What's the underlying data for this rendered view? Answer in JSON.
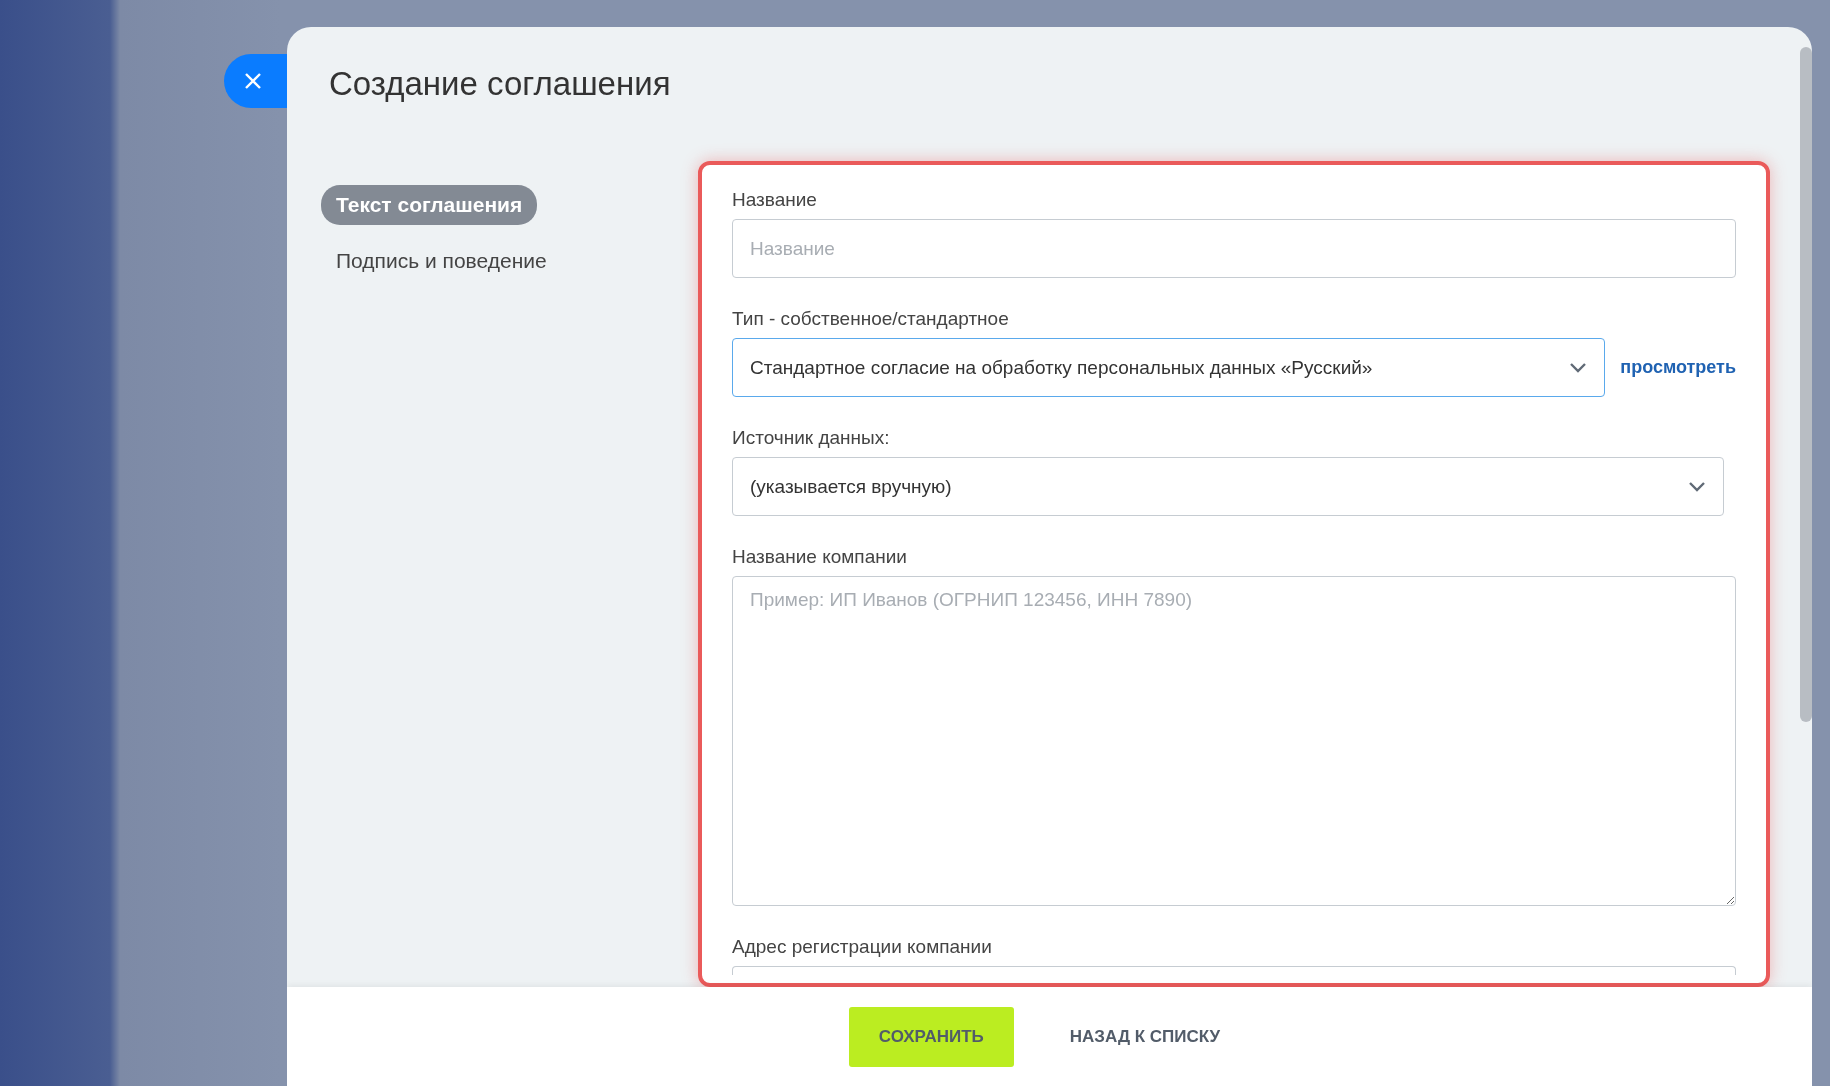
{
  "title": "Создание соглашения",
  "nav": [
    {
      "label": "Текст соглашения",
      "selected": true
    },
    {
      "label": "Подпись и поведение",
      "selected": false
    }
  ],
  "fields": [
    {
      "kind": "text",
      "label": "Название",
      "placeholder": "Название"
    },
    {
      "kind": "select",
      "label": "Тип - собственное/стандартное",
      "value": "Стандартное согласие на обработку персональных данных «Русский»",
      "link": "просмотреть",
      "focused": true
    },
    {
      "kind": "select",
      "label": "Источник данных:",
      "value": "(указывается вручную)",
      "focused": false
    },
    {
      "kind": "textarea",
      "label": "Название компании",
      "placeholder": "Пример: ИП Иванов (ОГРНИП 123456, ИНН 7890)"
    },
    {
      "kind": "cut_text",
      "label": "Адрес регистрации компании"
    }
  ],
  "buttons": [
    {
      "kind": "primary",
      "label": "СОХРАНИТЬ"
    },
    {
      "kind": "link",
      "label": "НАЗАД К СПИСКУ"
    }
  ]
}
